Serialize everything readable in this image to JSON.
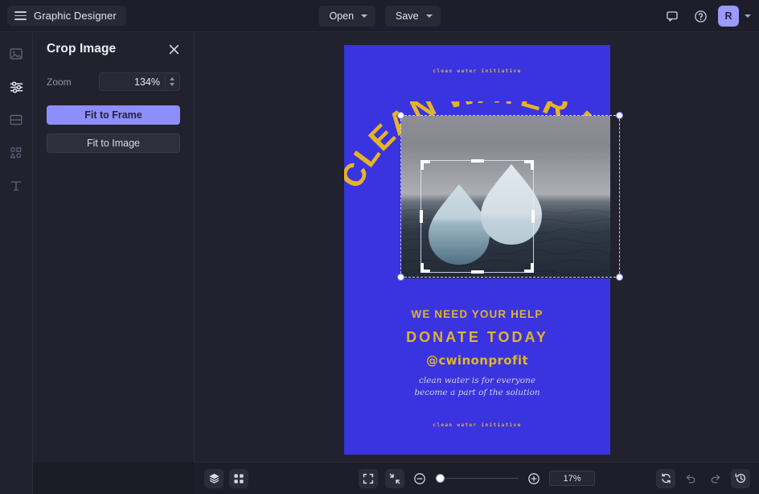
{
  "app": {
    "title": "Graphic Designer",
    "menu_icon": "hamburger-icon"
  },
  "topbar": {
    "buttons": [
      {
        "label": "Open",
        "icon": "chevron-down-icon"
      },
      {
        "label": "Save",
        "icon": "chevron-down-icon"
      }
    ],
    "comment_icon": "comment-icon",
    "help_icon": "help-circle-icon",
    "avatar_initial": "R",
    "avatar_color": "#9a9aff",
    "avatar_caret": "chevron-down-icon"
  },
  "rail": {
    "items": [
      {
        "name": "image-tool",
        "icon": "image-icon",
        "active": false
      },
      {
        "name": "adjustments-tool",
        "icon": "sliders-icon",
        "active": true
      },
      {
        "name": "layout-tool",
        "icon": "layout-icon",
        "active": false
      },
      {
        "name": "shapes-tool",
        "icon": "shapes-icon",
        "active": false
      },
      {
        "name": "text-tool",
        "icon": "text-t-icon",
        "active": false
      }
    ]
  },
  "panel": {
    "title": "Crop Image",
    "close_icon": "close-x-icon",
    "zoom_label": "Zoom",
    "zoom_value": "134%",
    "fit_to_frame": "Fit to Frame",
    "fit_to_image": "Fit to Image",
    "primary_color": "#8d8dfb"
  },
  "poster": {
    "background_color": "#3a33e0",
    "accent_color": "#e0b52a",
    "kicker_top": "clean water initiative",
    "headline_arc": "CLEAN WATER MATTERS",
    "message_1": "WE NEED YOUR HELP",
    "message_2": "DONATE TODAY",
    "handle": "@cwinonprofit",
    "script_line_1": "clean water is for everyone",
    "script_line_2": "become a part of the solution",
    "kicker_bottom": "clean water initiative"
  },
  "bottombar": {
    "layers_icon": "layers-icon",
    "grid_icon": "grid-icon",
    "expand_icon": "expand-fullscreen-icon",
    "contract_icon": "contract-fit-icon",
    "zoom_out_icon": "zoom-out-minus-icon",
    "zoom_in_icon": "zoom-in-plus-icon",
    "zoom_level": "17%",
    "refresh_icon": "refresh-sync-icon",
    "undo_icon": "undo-arrow-icon",
    "redo_icon": "redo-arrow-icon",
    "history_icon": "history-clock-icon"
  }
}
